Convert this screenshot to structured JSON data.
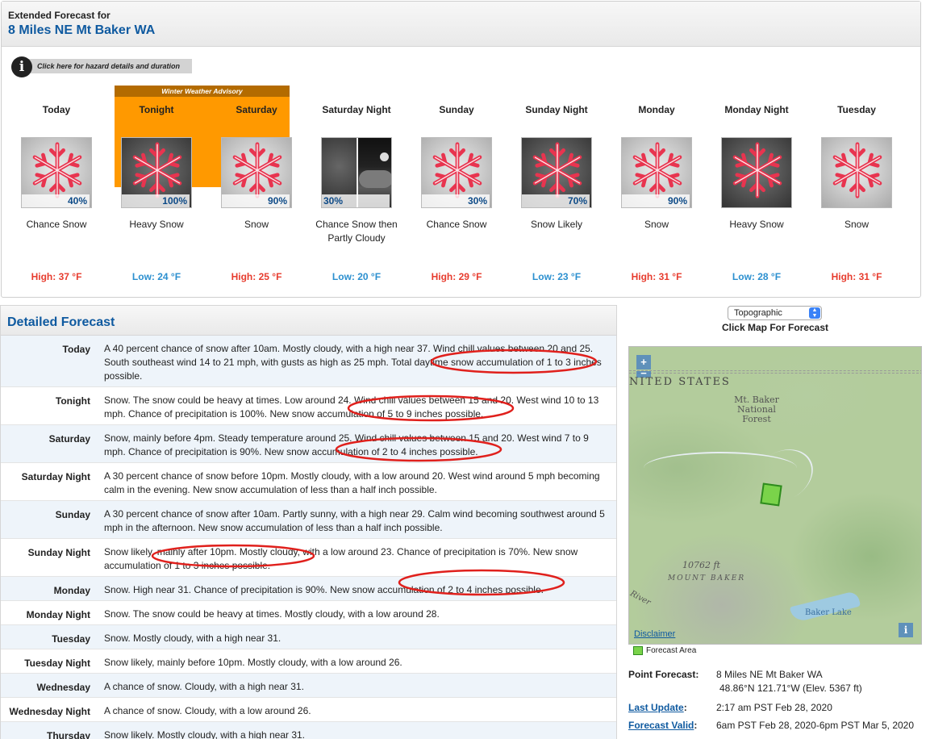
{
  "header": {
    "title": "Extended Forecast for",
    "location": "8 Miles NE Mt Baker WA"
  },
  "hazard": {
    "link_text": "Click here for hazard details and duration",
    "advisory": "Winter Weather Advisory"
  },
  "periods": [
    {
      "name": "Today",
      "desc": "Chance Snow",
      "pct": "40%",
      "temp": "High: 37 °F",
      "kind": "high",
      "icon": "snow-icon"
    },
    {
      "name": "Tonight",
      "desc": "Heavy Snow",
      "pct": "100%",
      "temp": "Low: 24 °F",
      "kind": "low",
      "icon": "snow-icon"
    },
    {
      "name": "Saturday",
      "desc": "Snow",
      "pct": "90%",
      "temp": "High: 25 °F",
      "kind": "high",
      "icon": "snow-icon"
    },
    {
      "name": "Saturday Night",
      "desc": "Chance Snow then Partly Cloudy",
      "pct": "30%",
      "temp": "Low: 20 °F",
      "kind": "low",
      "icon": "snow-then-partly-cloudy-icon"
    },
    {
      "name": "Sunday",
      "desc": "Chance Snow",
      "pct": "30%",
      "temp": "High: 29 °F",
      "kind": "high",
      "icon": "snow-icon"
    },
    {
      "name": "Sunday Night",
      "desc": "Snow Likely",
      "pct": "70%",
      "temp": "Low: 23 °F",
      "kind": "low",
      "icon": "snow-icon"
    },
    {
      "name": "Monday",
      "desc": "Snow",
      "pct": "90%",
      "temp": "High: 31 °F",
      "kind": "high",
      "icon": "snow-icon"
    },
    {
      "name": "Monday Night",
      "desc": "Heavy Snow",
      "pct": "",
      "temp": "Low: 28 °F",
      "kind": "low",
      "icon": "snow-icon"
    },
    {
      "name": "Tuesday",
      "desc": "Snow",
      "pct": "",
      "temp": "High: 31 °F",
      "kind": "high",
      "icon": "snow-icon"
    }
  ],
  "detailed": {
    "title": "Detailed Forecast",
    "rows": [
      {
        "label": "Today",
        "text": "A 40 percent chance of snow after 10am. Mostly cloudy, with a high near 37. Wind chill values between 20 and 25. South southeast wind 14 to 21 mph, with gusts as high as 25 mph. Total daytime snow accumulation of 1 to 3 inches possible."
      },
      {
        "label": "Tonight",
        "text": "Snow. The snow could be heavy at times. Low around 24. Wind chill values between 15 and 20. West wind 10 to 13 mph. Chance of precipitation is 100%. New snow accumulation of 5 to 9 inches possible."
      },
      {
        "label": "Saturday",
        "text": "Snow, mainly before 4pm. Steady temperature around 25. Wind chill values between 15 and 20. West wind 7 to 9 mph. Chance of precipitation is 90%. New snow accumulation of 2 to 4 inches possible."
      },
      {
        "label": "Saturday Night",
        "text": "A 30 percent chance of snow before 10pm. Mostly cloudy, with a low around 20. West wind around 5 mph becoming calm in the evening. New snow accumulation of less than a half inch possible."
      },
      {
        "label": "Sunday",
        "text": "A 30 percent chance of snow after 10am. Partly sunny, with a high near 29. Calm wind becoming southwest around 5 mph in the afternoon. New snow accumulation of less than a half inch possible."
      },
      {
        "label": "Sunday Night",
        "text": "Snow likely, mainly after 10pm. Mostly cloudy, with a low around 23. Chance of precipitation is 70%. New snow accumulation of 1 to 3 inches possible."
      },
      {
        "label": "Monday",
        "text": "Snow. High near 31. Chance of precipitation is 90%. New snow accumulation of 2 to 4 inches possible."
      },
      {
        "label": "Monday Night",
        "text": "Snow. The snow could be heavy at times. Mostly cloudy, with a low around 28."
      },
      {
        "label": "Tuesday",
        "text": "Snow. Mostly cloudy, with a high near 31."
      },
      {
        "label": "Tuesday Night",
        "text": "Snow likely, mainly before 10pm. Mostly cloudy, with a low around 26."
      },
      {
        "label": "Wednesday",
        "text": "A chance of snow. Cloudy, with a high near 31."
      },
      {
        "label": "Wednesday Night",
        "text": "A chance of snow. Cloudy, with a low around 26."
      },
      {
        "label": "Thursday",
        "text": "Snow likely. Mostly cloudy, with a high near 31."
      }
    ]
  },
  "map": {
    "layer_select": "Topographic",
    "caption": "Click Map For Forecast",
    "labels": {
      "country": "NITED STATES",
      "forest": "Mt. Baker\nNational\nForest",
      "elevation": "10762 ft",
      "mountain": "MOUNT BAKER",
      "lake": "Baker Lake",
      "river": "River"
    },
    "disclaimer": "Disclaimer",
    "legend": "Forecast Area",
    "zoom_in": "+",
    "zoom_out": "−"
  },
  "point_info": {
    "point_forecast_label": "Point Forecast:",
    "point_forecast_value": "8 Miles NE Mt Baker WA",
    "coords": "48.86°N 121.71°W (Elev. 5367 ft)",
    "last_update_label": "Last Update",
    "last_update_colon": ":",
    "last_update_value": "2:17 am PST Feb 28, 2020",
    "forecast_valid_label": "Forecast Valid",
    "forecast_valid_colon": ":",
    "forecast_valid_value": "6am PST Feb 28, 2020-6pm PST Mar 5, 2020"
  },
  "colors": {
    "link_blue": "#0f5aa0",
    "high_temp": "#e73c2e",
    "low_temp": "#2b8fcf",
    "advisory_orange": "#ff9900",
    "annotation_red": "#e0201c"
  }
}
